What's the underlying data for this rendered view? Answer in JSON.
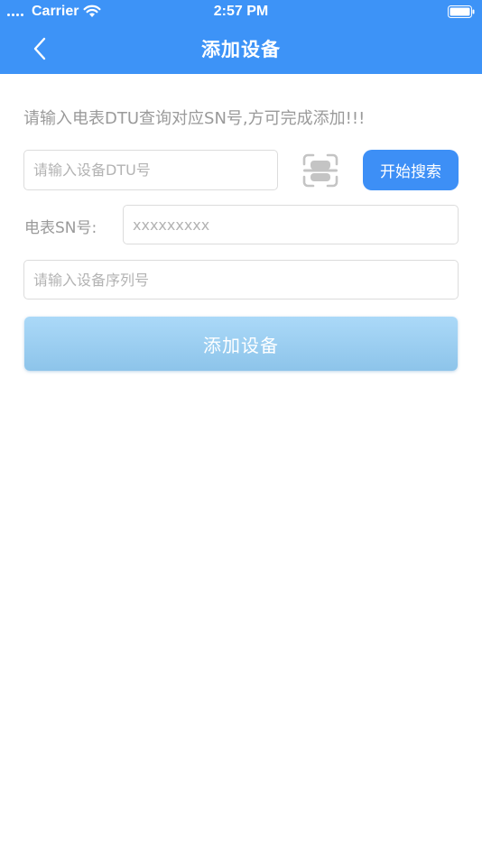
{
  "status_bar": {
    "carrier": "Carrier",
    "time": "2:57 PM",
    "wifi_icon": "wifi-icon",
    "battery_icon": "battery-full-icon"
  },
  "nav": {
    "title": "添加设备",
    "back_icon": "chevron-left-icon"
  },
  "form": {
    "hint": "请输入电表DTU查询对应SN号,方可完成添加!!!",
    "dtu_input": {
      "value": "",
      "placeholder": "请输入设备DTU号"
    },
    "scan_icon": "scan-icon",
    "search_label": "开始搜索",
    "sn_label": "电表SN号:",
    "sn_input": {
      "value": "",
      "placeholder": "xxxxxxxxx"
    },
    "serial_input": {
      "value": "",
      "placeholder": "请输入设备序列号"
    },
    "add_label": "添加设备"
  },
  "colors": {
    "header_bg": "#3d93f7",
    "search_button_bg": "#3d8ff6",
    "add_button_gradient_top": "#abd9f8",
    "add_button_gradient_bottom": "#8dc4ea",
    "hint_text": "#9a9a9a"
  }
}
